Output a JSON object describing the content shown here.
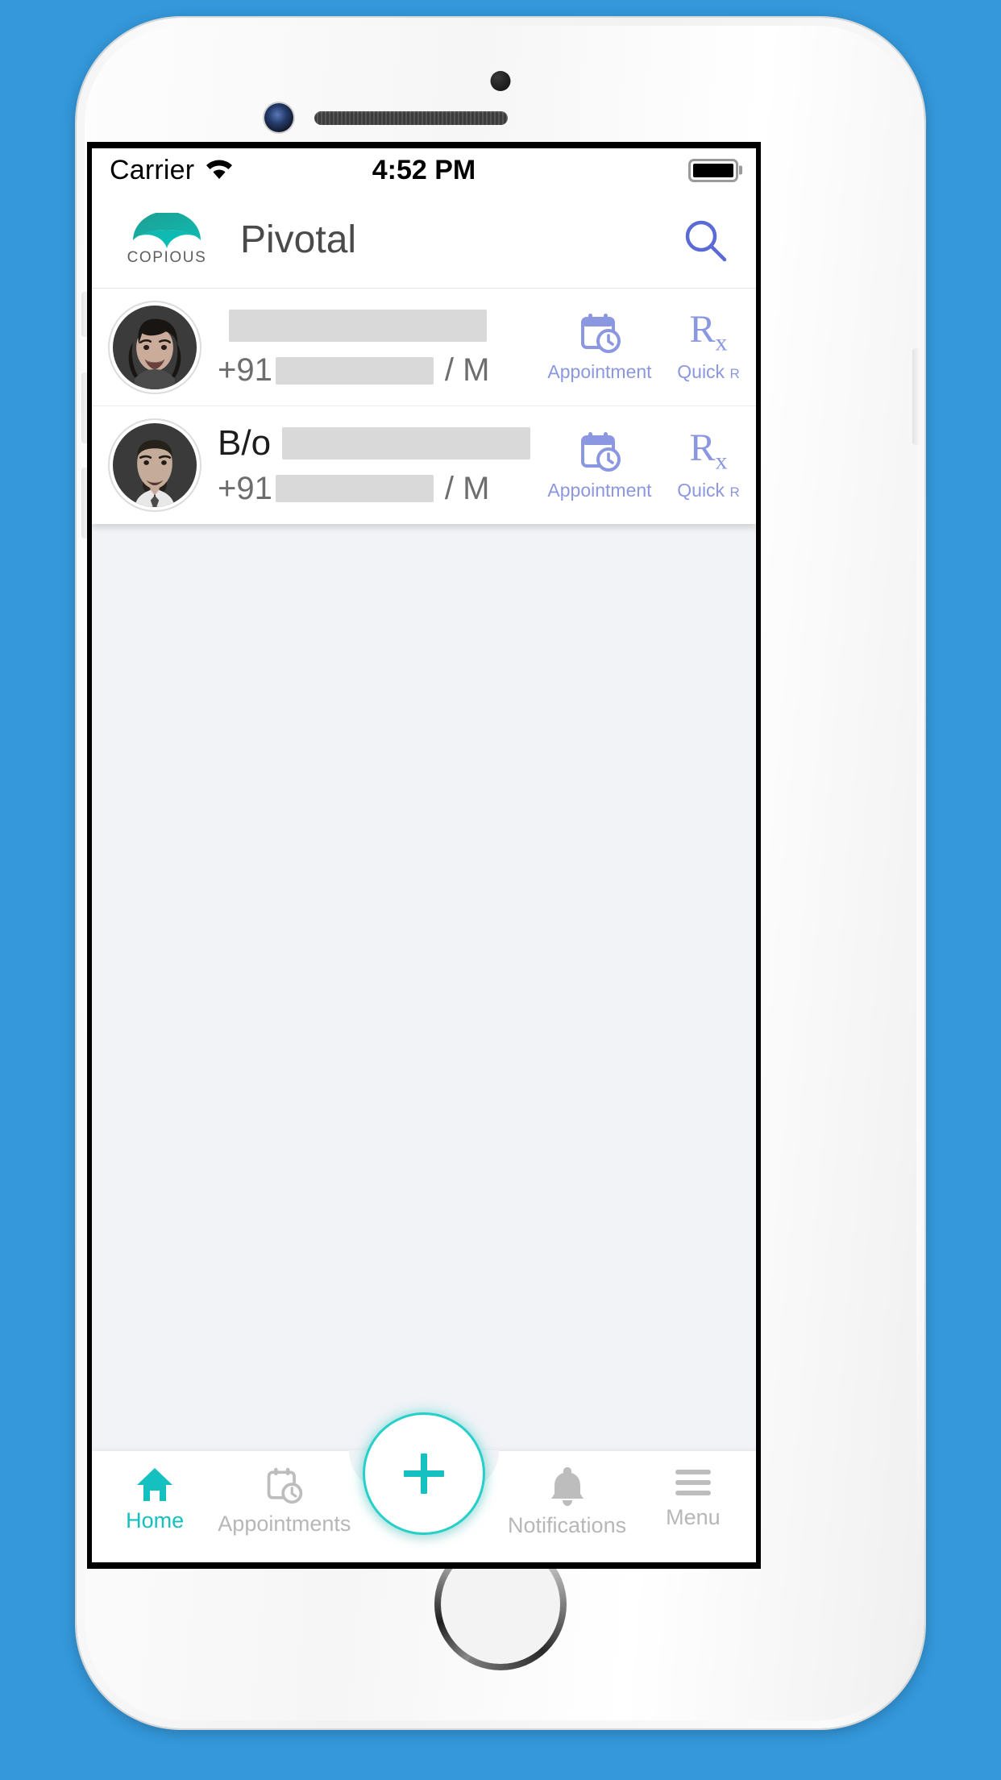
{
  "device": {
    "camera_icon": "front-camera-lens",
    "speaker_icon": "earpiece-speaker",
    "sensor_icon": "proximity-sensor",
    "home_button_label": "home-button"
  },
  "status_bar": {
    "carrier": "Carrier",
    "wifi_icon": "wifi-icon",
    "time": "4:52 PM",
    "battery_icon": "battery-full-icon"
  },
  "header": {
    "brand_name": "COPIOUS",
    "brand_logo_icon": "copious-arc-logo",
    "title": "Pivotal",
    "search_icon": "search-icon"
  },
  "colors": {
    "brand_teal": "#14c0c0",
    "accent_blue": "#5b6bd6",
    "action_blue": "#8b97e0",
    "background_blue": "#3498db",
    "body_bg": "#f1f3f7",
    "redaction_gray": "#d9d9d9"
  },
  "patients": [
    {
      "avatar_icon": "patient-avatar-female",
      "name_prefix": "",
      "name_redacted": true,
      "phone_country_code": "+91",
      "phone_redacted": true,
      "gender": "/ M",
      "actions": [
        {
          "icon": "calendar-clock-icon",
          "label": "Appointment"
        },
        {
          "icon": "rx-icon",
          "label": "Quick ",
          "label_small": "R"
        }
      ]
    },
    {
      "avatar_icon": "patient-avatar-male",
      "name_prefix": "B/o",
      "name_redacted": true,
      "phone_country_code": "+91",
      "phone_redacted": true,
      "gender": "/ M",
      "actions": [
        {
          "icon": "calendar-clock-icon",
          "label": "Appointment"
        },
        {
          "icon": "rx-icon",
          "label": "Quick ",
          "label_small": "R"
        }
      ]
    }
  ],
  "bottom_nav": {
    "items": [
      {
        "label": "Home",
        "icon": "home-icon",
        "active": true
      },
      {
        "label": "Appointments",
        "icon": "calendar-clock-icon",
        "active": false
      },
      {
        "label": "Notifications",
        "icon": "bell-icon",
        "active": false
      },
      {
        "label": "Menu",
        "icon": "hamburger-menu-icon",
        "active": false
      }
    ],
    "fab": {
      "icon": "plus-icon",
      "label": "Add"
    }
  }
}
